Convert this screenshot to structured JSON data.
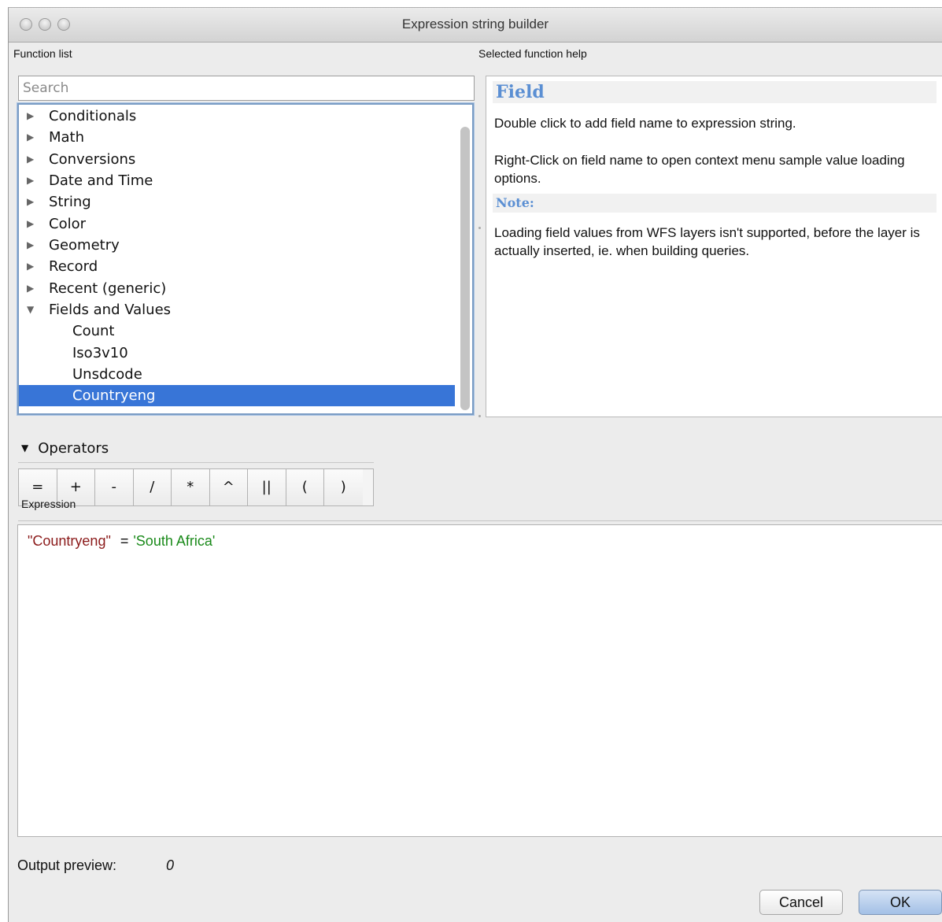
{
  "window": {
    "title": "Expression string builder"
  },
  "function_list": {
    "label": "Function list",
    "search": {
      "placeholder": "Search",
      "value": ""
    },
    "items": [
      {
        "label": "Conditionals",
        "expanded": false
      },
      {
        "label": "Math",
        "expanded": false
      },
      {
        "label": "Conversions",
        "expanded": false
      },
      {
        "label": "Date and Time",
        "expanded": false
      },
      {
        "label": "String",
        "expanded": false
      },
      {
        "label": "Color",
        "expanded": false
      },
      {
        "label": "Geometry",
        "expanded": false
      },
      {
        "label": "Record",
        "expanded": false
      },
      {
        "label": "Recent (generic)",
        "expanded": false
      },
      {
        "label": "Fields and Values",
        "expanded": true
      }
    ],
    "children": [
      {
        "label": "Count"
      },
      {
        "label": "Iso3v10"
      },
      {
        "label": "Unsdcode"
      },
      {
        "label": "Countryeng",
        "selected": true
      }
    ]
  },
  "help": {
    "label": "Selected function help",
    "heading": "Field",
    "para1": "Double click to add field name to expression string.",
    "para2": "Right-Click on field name to open context menu sample value loading options.",
    "note_heading": "Note:",
    "note": "Loading field values from WFS layers isn't supported, before the layer is actually inserted, ie. when building queries."
  },
  "operators": {
    "label": "Operators",
    "buttons": [
      "=",
      "+",
      "-",
      "/",
      "*",
      "^",
      "||",
      "(",
      ")"
    ]
  },
  "expression": {
    "label": "Expression",
    "field": "\"Countryeng\"",
    "operator": "=",
    "string_literal": "'South Africa'"
  },
  "output_preview": {
    "label": "Output preview:",
    "value": "0"
  },
  "buttons": {
    "cancel": "Cancel",
    "ok": "OK"
  },
  "colors": {
    "selection": "#3875d7",
    "help_heading": "#5b8fd3",
    "field_token": "#8b1a1a",
    "string_token": "#1a8a1a"
  }
}
